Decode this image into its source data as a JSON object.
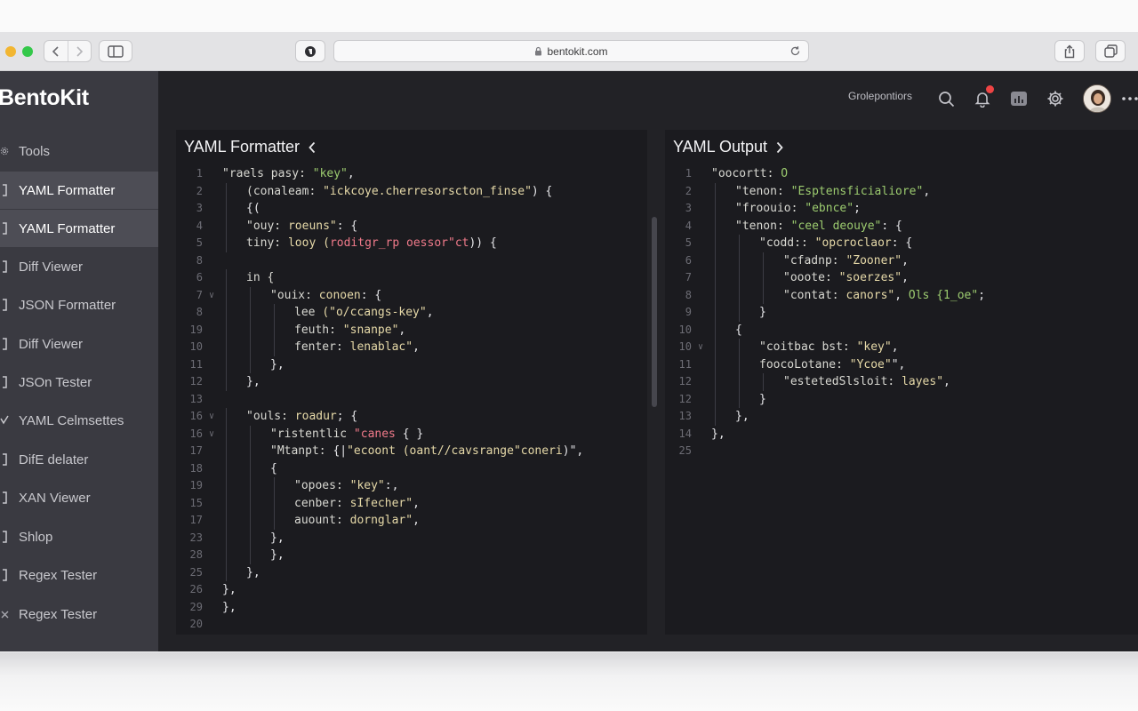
{
  "browser": {
    "url": "bentokit.com"
  },
  "app": {
    "brand": "BentoKit",
    "sidebar": {
      "items": [
        {
          "label": "Tools",
          "icon": "gear-icon",
          "active": false
        },
        {
          "label": "YAML Formatter",
          "icon": "bracket-icon",
          "active": true
        },
        {
          "label": "YAML Formatter",
          "icon": "bracket-icon",
          "active": true
        },
        {
          "label": "Diff Viewer",
          "icon": "bracket-icon",
          "active": false
        },
        {
          "label": "JSON Formatter",
          "icon": "bracket-icon",
          "active": false
        },
        {
          "label": "Diff Viewer",
          "icon": "bracket-icon",
          "active": false
        },
        {
          "label": "JSOn Tester",
          "icon": "bracket-icon",
          "active": false
        },
        {
          "label": "YAML Celmsettes",
          "icon": "check-icon",
          "active": false
        },
        {
          "label": "DifE delater",
          "icon": "bracket-icon",
          "active": false
        },
        {
          "label": "XAN Viewer",
          "icon": "bracket-icon",
          "active": false
        },
        {
          "label": "Shlop",
          "icon": "bracket-icon",
          "active": false
        },
        {
          "label": "Regex Tester",
          "icon": "bracket-icon",
          "active": false
        },
        {
          "label": "Regex Tester",
          "icon": "close-icon",
          "active": false
        }
      ]
    },
    "header": {
      "profile_link": "Grolepontiors",
      "notification_dot_color": "#ef4444"
    },
    "editor": {
      "title": "YAML Formatter",
      "lines": [
        {
          "n": "1",
          "fold": "",
          "indent": 0,
          "html": "<span class='s'>\"raels pasy: </span><span class='g'>\"key\"</span><span class='p'>,</span>"
        },
        {
          "n": "2",
          "fold": "",
          "indent": 1,
          "html": "<span class='s'>(conaleam: </span><span class='k'>\"ickcoye.cherresorscton_finse\"</span><span class='p'>) {</span>"
        },
        {
          "n": "3",
          "fold": "",
          "indent": 1,
          "html": "<span class='p'>{(</span>"
        },
        {
          "n": "4",
          "fold": "",
          "indent": 1,
          "html": "<span class='s'>\"ouy: </span><span class='k'>roeuns\"</span><span class='p'>: {</span>"
        },
        {
          "n": "5",
          "fold": "",
          "indent": 1,
          "html": "<span class='s'>tiny: </span><span class='k'>looy (</span><span class='r'>roditgr_rp oessor\"ct</span><span class='p'>)) {</span>"
        },
        {
          "n": "8",
          "fold": "",
          "indent": 0,
          "html": ""
        },
        {
          "n": "6",
          "fold": "",
          "indent": 1,
          "html": "<span class='s'>in {</span>"
        },
        {
          "n": "7",
          "fold": "v",
          "indent": 2,
          "html": "<span class='s'>\"ouix: </span><span class='k'>conoen</span><span class='p'>: {</span>"
        },
        {
          "n": "8",
          "fold": "",
          "indent": 3,
          "html": "<span class='s'>lee </span><span class='k'>(\"o/ccangs-key\"</span><span class='p'>,</span>"
        },
        {
          "n": "19",
          "fold": "",
          "indent": 3,
          "html": "<span class='s'>feuth: </span><span class='k'>\"snanpe\"</span><span class='p'>,</span>"
        },
        {
          "n": "10",
          "fold": "",
          "indent": 3,
          "html": "<span class='s'>fenter: </span><span class='k'>lenablac\"</span><span class='p'>,</span>"
        },
        {
          "n": "11",
          "fold": "",
          "indent": 2,
          "html": "<span class='p'>},</span>"
        },
        {
          "n": "12",
          "fold": "",
          "indent": 1,
          "html": "<span class='p'>},</span>"
        },
        {
          "n": "13",
          "fold": "",
          "indent": 0,
          "html": ""
        },
        {
          "n": "16",
          "fold": "v",
          "indent": 1,
          "html": "<span class='s'>\"ouls: </span><span class='k'>roadur</span><span class='p'>; {</span>"
        },
        {
          "n": "16",
          "fold": "v",
          "indent": 2,
          "html": "<span class='s'>\"ristentlic </span><span class='r'>\"canes</span><span class='p'> { }</span>"
        },
        {
          "n": "17",
          "fold": "",
          "indent": 2,
          "html": "<span class='s'>\"Mtanpt: </span><span class='p'>{|</span><span class='k'>\"ecoont (oant//cavsrange\"coneri</span><span class='p'>)\",</span>"
        },
        {
          "n": "18",
          "fold": "",
          "indent": 2,
          "html": "<span class='p'>{</span>"
        },
        {
          "n": "19",
          "fold": "",
          "indent": 3,
          "html": "<span class='s'>\"opoes: </span><span class='k'>\"key\"</span><span class='p'>:,</span>"
        },
        {
          "n": "15",
          "fold": "",
          "indent": 3,
          "html": "<span class='s'>cenber: </span><span class='k'>sIfecher\"</span><span class='p'>,</span>"
        },
        {
          "n": "17",
          "fold": "",
          "indent": 3,
          "html": "<span class='s'>auount: </span><span class='k'>dornglar\"</span><span class='p'>,</span>"
        },
        {
          "n": "23",
          "fold": "",
          "indent": 2,
          "html": "<span class='p'>},</span>"
        },
        {
          "n": "28",
          "fold": "",
          "indent": 2,
          "html": "<span class='p'>},</span>"
        },
        {
          "n": "25",
          "fold": "",
          "indent": 1,
          "html": "<span class='p'>},</span>"
        },
        {
          "n": "26",
          "fold": "",
          "indent": 0,
          "html": "<span class='p'>},</span>"
        },
        {
          "n": "29",
          "fold": "",
          "indent": 0,
          "html": "<span class='p'>},</span>"
        },
        {
          "n": "20",
          "fold": "",
          "indent": 0,
          "html": ""
        }
      ]
    },
    "output": {
      "title": "YAML Output",
      "lines": [
        {
          "n": "1",
          "fold": "",
          "indent": 0,
          "html": "<span class='s'>\"oocortt: </span><span class='g'>O</span>"
        },
        {
          "n": "2",
          "fold": "",
          "indent": 1,
          "html": "<span class='s'>\"tenon: </span><span class='g'>\"Esptensficialiore\"</span><span class='p'>,</span>"
        },
        {
          "n": "3",
          "fold": "",
          "indent": 1,
          "html": "<span class='s'>\"froouio: </span><span class='g'>\"ebnce\"</span><span class='p'>;</span>"
        },
        {
          "n": "4",
          "fold": "",
          "indent": 1,
          "html": "<span class='s'>\"tenon: </span><span class='g'>\"ceel deouye\"</span><span class='p'>: {</span>"
        },
        {
          "n": "5",
          "fold": "",
          "indent": 2,
          "html": "<span class='s'>\"codd:: </span><span class='k'>\"opcroclaor</span><span class='p'>: {</span>"
        },
        {
          "n": "6",
          "fold": "",
          "indent": 3,
          "html": "<span class='s'>\"cfadnp: </span><span class='k'>\"Zooner\"</span><span class='p'>,</span>"
        },
        {
          "n": "7",
          "fold": "",
          "indent": 3,
          "html": "<span class='s'>\"ooote: </span><span class='k'>\"soerzes\"</span><span class='p'>,</span>"
        },
        {
          "n": "8",
          "fold": "",
          "indent": 3,
          "html": "<span class='s'>\"contat: </span><span class='k'>canors\"</span><span class='p'>, </span><span class='g'>Ols {1_oe\"</span><span class='p'>;</span>"
        },
        {
          "n": "9",
          "fold": "",
          "indent": 2,
          "html": "<span class='p'>}</span>"
        },
        {
          "n": "10",
          "fold": "",
          "indent": 1,
          "html": "<span class='p'>{</span>"
        },
        {
          "n": "10",
          "fold": "v",
          "indent": 2,
          "html": "<span class='s'>\"coitbac bst: </span><span class='k'>\"key\"</span><span class='p'>,</span>"
        },
        {
          "n": "11",
          "fold": "",
          "indent": 2,
          "html": "<span class='s'>foocoLotane: </span><span class='k'>\"Ycoe\"</span><span class='p'>\",</span>"
        },
        {
          "n": "12",
          "fold": "",
          "indent": 3,
          "html": "<span class='s'>\"estetedSlsloit: </span><span class='k'>layes\"</span><span class='p'>,</span>"
        },
        {
          "n": "12",
          "fold": "",
          "indent": 2,
          "html": "<span class='p'>}</span>"
        },
        {
          "n": "13",
          "fold": "",
          "indent": 1,
          "html": "<span class='p'>},</span>"
        },
        {
          "n": "14",
          "fold": "",
          "indent": 0,
          "html": "<span class='p'>},</span>"
        },
        {
          "n": "25",
          "fold": "",
          "indent": 0,
          "html": ""
        }
      ]
    }
  }
}
